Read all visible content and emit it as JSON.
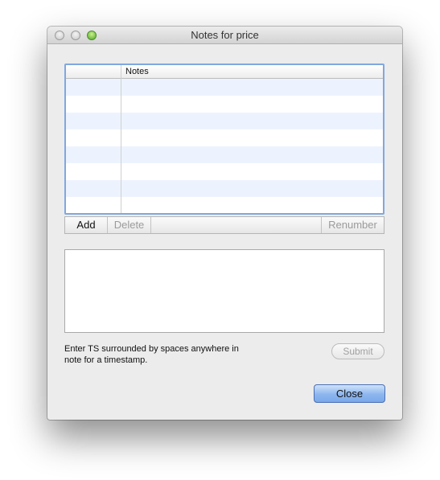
{
  "window": {
    "title": "Notes for price"
  },
  "table": {
    "columns": [
      "",
      "Notes"
    ],
    "rows": []
  },
  "segments": {
    "add": "Add",
    "delete": "Delete",
    "renumber": "Renumber"
  },
  "note_editor": {
    "value": ""
  },
  "hint": {
    "line1": "Enter TS surrounded by spaces anywhere in",
    "line2": "note for a timestamp."
  },
  "buttons": {
    "submit": "Submit",
    "close": "Close"
  },
  "colors": {
    "focus_ring": "#7fa8e0",
    "stripe": "#edf3fe",
    "default_button": "#8db6ee"
  }
}
